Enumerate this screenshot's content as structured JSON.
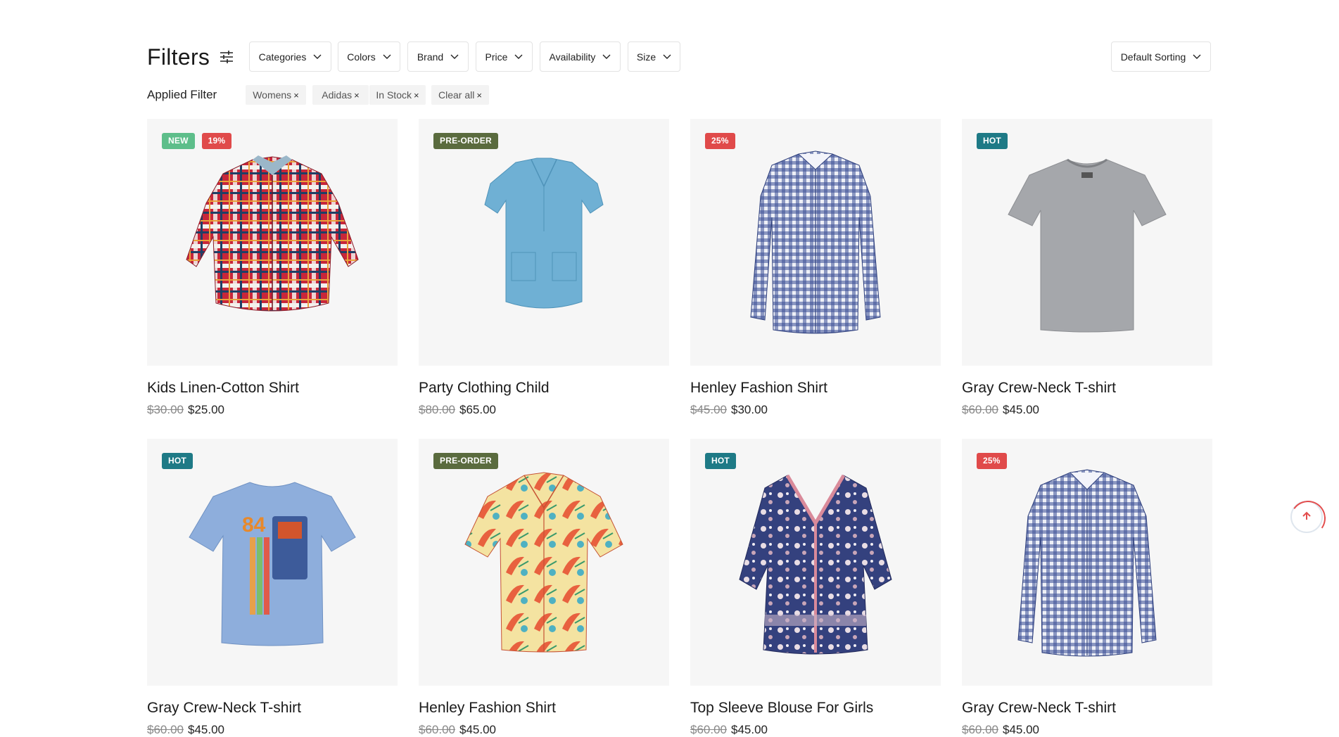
{
  "filters": {
    "title": "Filters",
    "dropdowns": [
      {
        "label": "Categories"
      },
      {
        "label": "Colors"
      },
      {
        "label": "Brand"
      },
      {
        "label": "Price"
      },
      {
        "label": "Availability"
      },
      {
        "label": "Size"
      }
    ],
    "sorting": {
      "label": "Default Sorting"
    }
  },
  "applied": {
    "label": "Applied Filter",
    "chips": [
      {
        "label": "Womens"
      },
      {
        "label": "Adidas"
      },
      {
        "label": "In Stock"
      },
      {
        "label": "Clear all"
      }
    ],
    "remove_symbol": "×"
  },
  "products": [
    {
      "name": "Kids Linen-Cotton Shirt",
      "old_price": "$30.00",
      "price": "$25.00",
      "badges": [
        {
          "text": "NEW",
          "color": "#5dbe8a"
        },
        {
          "text": "19%",
          "color": "#e04a4a"
        }
      ],
      "image": "plaid-shirt"
    },
    {
      "name": "Party Clothing Child",
      "old_price": "$80.00",
      "price": "$65.00",
      "badges": [
        {
          "text": "PRE-ORDER",
          "color": "#5a6b3e"
        }
      ],
      "image": "blue-scrub-top"
    },
    {
      "name": "Henley Fashion Shirt",
      "old_price": "$45.00",
      "price": "$30.00",
      "badges": [
        {
          "text": "25%",
          "color": "#e04a4a"
        }
      ],
      "image": "gingham-shirt"
    },
    {
      "name": "Gray Crew-Neck T-shirt",
      "old_price": "$60.00",
      "price": "$45.00",
      "badges": [
        {
          "text": "HOT",
          "color": "#1e7a86"
        }
      ],
      "image": "gray-tshirt"
    },
    {
      "name": "Gray Crew-Neck T-shirt",
      "old_price": "$60.00",
      "price": "$45.00",
      "badges": [
        {
          "text": "HOT",
          "color": "#1e7a86"
        }
      ],
      "image": "graphic-tshirt"
    },
    {
      "name": "Henley Fashion Shirt",
      "old_price": "$60.00",
      "price": "$45.00",
      "badges": [
        {
          "text": "PRE-ORDER",
          "color": "#5a6b3e"
        }
      ],
      "image": "hawaiian-shirt"
    },
    {
      "name": "Top Sleeve Blouse For Girls",
      "old_price": "$60.00",
      "price": "$45.00",
      "badges": [
        {
          "text": "HOT",
          "color": "#1e7a86"
        }
      ],
      "image": "paisley-blouse"
    },
    {
      "name": "Gray Crew-Neck T-shirt",
      "old_price": "$60.00",
      "price": "$45.00",
      "badges": [
        {
          "text": "25%",
          "color": "#e04a4a"
        }
      ],
      "image": "gingham-shirt"
    }
  ],
  "graphic_text": "84",
  "colors": {
    "accent_red": "#e34d4d",
    "border": "#e3e3e3",
    "card_bg": "#f6f6f6"
  }
}
